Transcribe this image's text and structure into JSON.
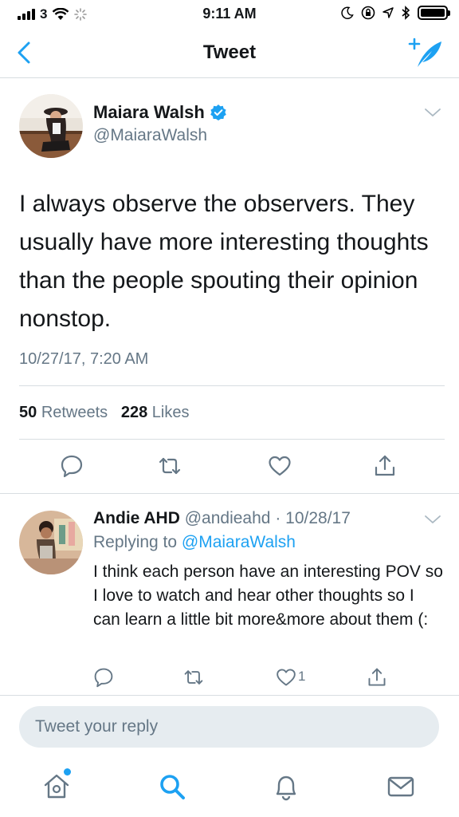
{
  "status_bar": {
    "carrier": "3",
    "time": "9:11 AM",
    "battery_level": 1.0
  },
  "nav": {
    "title": "Tweet",
    "back_icon": "chevron-left-icon",
    "compose_icon": "compose-tweet-icon"
  },
  "tweet": {
    "author_name": "Maiara Walsh",
    "author_handle": "@MaiaraWalsh",
    "verified": true,
    "text": "I always observe the observers. They usually have more interesting thoughts than the people spouting their opinion nonstop.",
    "timestamp": "10/27/17, 7:20 AM",
    "retweets_count": "50",
    "retweets_label": "Retweets",
    "likes_count": "228",
    "likes_label": "Likes"
  },
  "reply": {
    "author_name": "Andie AHD",
    "author_handle": "@andieahd",
    "separator": " · ",
    "date": "10/28/17",
    "replying_label": "Replying to",
    "replying_to": "@MaiaraWalsh",
    "text": "I think each person have an interesting POV so I love to watch and hear other thoughts so I can learn a little bit more&more about them (:",
    "like_count": "1"
  },
  "composer": {
    "placeholder": "Tweet your reply"
  },
  "tabs": [
    "home-icon",
    "search-icon",
    "notifications-icon",
    "messages-icon"
  ],
  "colors": {
    "accent": "#1da1f2",
    "secondary_text": "#657786",
    "divider": "#d8dde1"
  }
}
